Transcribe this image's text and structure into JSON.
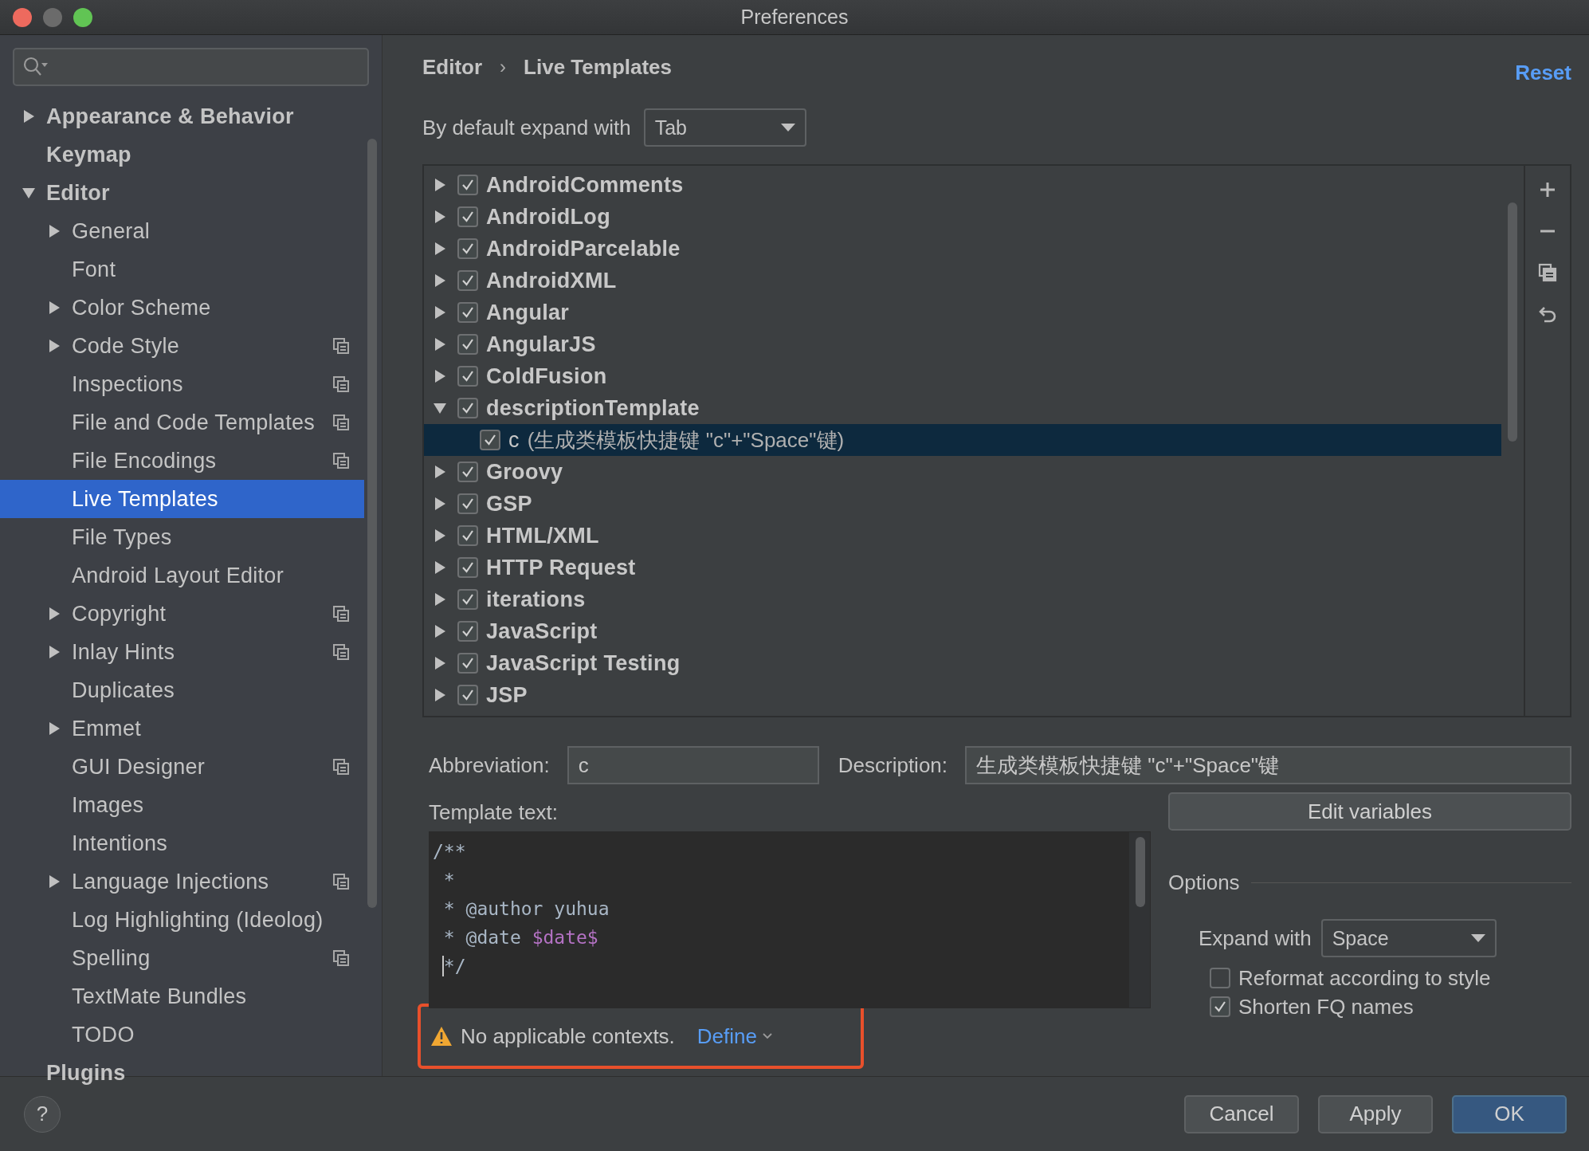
{
  "window": {
    "title": "Preferences"
  },
  "sidebar": {
    "items": [
      {
        "label": "Appearance & Behavior",
        "expandable": true,
        "expanded": false,
        "project_scoped": false,
        "selected": false
      },
      {
        "label": "Keymap",
        "expandable": false,
        "project_scoped": false,
        "selected": false
      },
      {
        "label": "Editor",
        "expandable": true,
        "expanded": true,
        "project_scoped": false,
        "selected": false,
        "children": [
          {
            "label": "General",
            "expandable": true,
            "expanded": false,
            "project_scoped": false,
            "selected": false
          },
          {
            "label": "Font",
            "expandable": false,
            "project_scoped": false,
            "selected": false
          },
          {
            "label": "Color Scheme",
            "expandable": true,
            "expanded": false,
            "project_scoped": false,
            "selected": false
          },
          {
            "label": "Code Style",
            "expandable": true,
            "expanded": false,
            "project_scoped": true,
            "selected": false
          },
          {
            "label": "Inspections",
            "expandable": false,
            "project_scoped": true,
            "selected": false
          },
          {
            "label": "File and Code Templates",
            "expandable": false,
            "project_scoped": true,
            "selected": false
          },
          {
            "label": "File Encodings",
            "expandable": false,
            "project_scoped": true,
            "selected": false
          },
          {
            "label": "Live Templates",
            "expandable": false,
            "project_scoped": false,
            "selected": true
          },
          {
            "label": "File Types",
            "expandable": false,
            "project_scoped": false,
            "selected": false
          },
          {
            "label": "Android Layout Editor",
            "expandable": false,
            "project_scoped": false,
            "selected": false
          },
          {
            "label": "Copyright",
            "expandable": true,
            "expanded": false,
            "project_scoped": true,
            "selected": false
          },
          {
            "label": "Inlay Hints",
            "expandable": true,
            "expanded": false,
            "project_scoped": true,
            "selected": false
          },
          {
            "label": "Duplicates",
            "expandable": false,
            "project_scoped": false,
            "selected": false
          },
          {
            "label": "Emmet",
            "expandable": true,
            "expanded": false,
            "project_scoped": false,
            "selected": false
          },
          {
            "label": "GUI Designer",
            "expandable": false,
            "project_scoped": true,
            "selected": false
          },
          {
            "label": "Images",
            "expandable": false,
            "project_scoped": false,
            "selected": false
          },
          {
            "label": "Intentions",
            "expandable": false,
            "project_scoped": false,
            "selected": false
          },
          {
            "label": "Language Injections",
            "expandable": true,
            "expanded": false,
            "project_scoped": true,
            "selected": false
          },
          {
            "label": "Log Highlighting (Ideolog)",
            "expandable": false,
            "project_scoped": false,
            "selected": false
          },
          {
            "label": "Spelling",
            "expandable": false,
            "project_scoped": true,
            "selected": false
          },
          {
            "label": "TextMate Bundles",
            "expandable": false,
            "project_scoped": false,
            "selected": false
          },
          {
            "label": "TODO",
            "expandable": false,
            "project_scoped": false,
            "selected": false
          }
        ]
      },
      {
        "label": "Plugins",
        "expandable": false,
        "project_scoped": false,
        "selected": false
      }
    ]
  },
  "breadcrumb": [
    "Editor",
    "Live Templates"
  ],
  "separator": "›",
  "reset": "Reset",
  "expand_default": {
    "label": "By default expand with",
    "value": "Tab"
  },
  "templates": [
    {
      "name": "AndroidComments",
      "checked": true,
      "expanded": false,
      "selected": false
    },
    {
      "name": "AndroidLog",
      "checked": true,
      "expanded": false,
      "selected": false
    },
    {
      "name": "AndroidParcelable",
      "checked": true,
      "expanded": false,
      "selected": false
    },
    {
      "name": "AndroidXML",
      "checked": true,
      "expanded": false,
      "selected": false
    },
    {
      "name": "Angular",
      "checked": true,
      "expanded": false,
      "selected": false
    },
    {
      "name": "AngularJS",
      "checked": true,
      "expanded": false,
      "selected": false
    },
    {
      "name": "ColdFusion",
      "checked": true,
      "expanded": false,
      "selected": false
    },
    {
      "name": "descriptionTemplate",
      "checked": true,
      "expanded": true,
      "selected": false,
      "children": [
        {
          "name": "c",
          "description": "(生成类模板快捷键 \"c\"+\"Space\"键)",
          "checked": true,
          "selected": true
        }
      ]
    },
    {
      "name": "Groovy",
      "checked": true,
      "expanded": false,
      "selected": false
    },
    {
      "name": "GSP",
      "checked": true,
      "expanded": false,
      "selected": false
    },
    {
      "name": "HTML/XML",
      "checked": true,
      "expanded": false,
      "selected": false
    },
    {
      "name": "HTTP Request",
      "checked": true,
      "expanded": false,
      "selected": false
    },
    {
      "name": "iterations",
      "checked": true,
      "expanded": false,
      "selected": false
    },
    {
      "name": "JavaScript",
      "checked": true,
      "expanded": false,
      "selected": false
    },
    {
      "name": "JavaScript Testing",
      "checked": true,
      "expanded": false,
      "selected": false
    },
    {
      "name": "JSP",
      "checked": true,
      "expanded": false,
      "selected": false
    }
  ],
  "abbreviation": {
    "label": "Abbreviation:",
    "value": "c"
  },
  "description": {
    "label": "Description:",
    "value": "生成类模板快捷键 \"c\"+\"Space\"键"
  },
  "template_text": {
    "label": "Template text:",
    "lines": [
      {
        "caret": false,
        "segments": [
          {
            "kind": "text",
            "text": "/**"
          }
        ]
      },
      {
        "caret": false,
        "segments": [
          {
            "kind": "text",
            "text": " *"
          }
        ]
      },
      {
        "caret": false,
        "segments": [
          {
            "kind": "text",
            "text": " * @author yuhua"
          }
        ]
      },
      {
        "caret": false,
        "segments": [
          {
            "kind": "text",
            "text": " * @date "
          },
          {
            "kind": "variable",
            "text": "$date$"
          }
        ]
      },
      {
        "caret": true,
        "segments": [
          {
            "kind": "text",
            "text": " */"
          }
        ]
      }
    ]
  },
  "edit_variables": "Edit variables",
  "options": {
    "title": "Options",
    "expand_with": {
      "label": "Expand with",
      "value": "Space"
    },
    "checkboxes": [
      {
        "label": "Reformat according to style",
        "checked": false
      },
      {
        "label": "Shorten FQ names",
        "checked": true
      }
    ]
  },
  "warning": {
    "text": "No applicable contexts.",
    "link": "Define",
    "highlighted": true
  },
  "footer": {
    "help": "?",
    "buttons": [
      {
        "label": "Cancel",
        "default": false
      },
      {
        "label": "Apply",
        "default": false
      },
      {
        "label": "OK",
        "default": true
      }
    ]
  }
}
